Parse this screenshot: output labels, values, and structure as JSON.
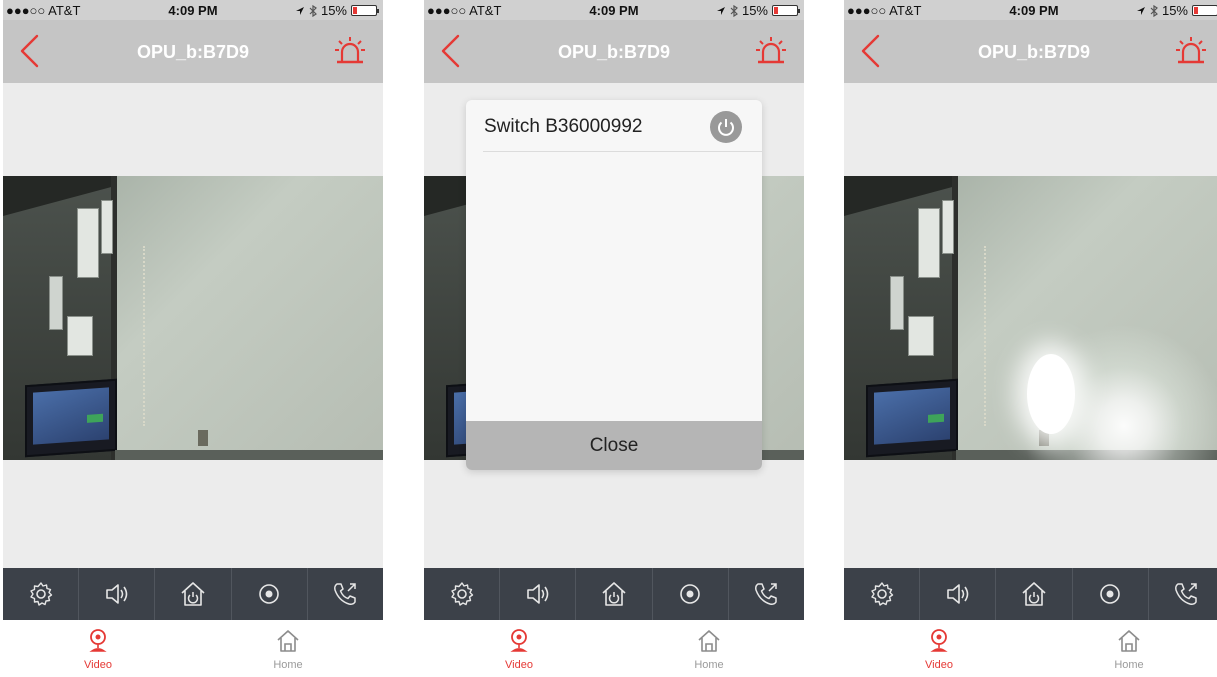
{
  "colors": {
    "accent": "#e53935",
    "navbar": "#c5c5c5",
    "control_bar": "#3c4149",
    "content_bg": "#ececec"
  },
  "screens": [
    {
      "status_bar": {
        "carrier": "●●●○○ AT&T",
        "time": "4:09 PM",
        "battery": "15%"
      },
      "nav": {
        "title": "OPU_b:B7D9",
        "back_icon": "chevron-left-icon",
        "alarm_icon": "siren-icon"
      },
      "video": {
        "lamp_on": false
      },
      "controls": [
        "gear-icon",
        "speaker-icon",
        "home-power-icon",
        "record-icon",
        "phone-call-icon"
      ],
      "tabs": [
        {
          "label": "Video",
          "icon": "camera-icon",
          "active": true
        },
        {
          "label": "Home",
          "icon": "home-icon",
          "active": false
        }
      ]
    },
    {
      "status_bar": {
        "carrier": "●●●○○ AT&T",
        "time": "4:09 PM",
        "battery": "15%"
      },
      "nav": {
        "title": "OPU_b:B7D9",
        "back_icon": "chevron-left-icon",
        "alarm_icon": "siren-icon"
      },
      "video": {
        "lamp_on": false
      },
      "dialog": {
        "switch_name": "Switch B36000992",
        "power_icon": "power-icon",
        "close_label": "Close"
      },
      "controls": [
        "gear-icon",
        "speaker-icon",
        "home-power-icon",
        "record-icon",
        "phone-call-icon"
      ],
      "tabs": [
        {
          "label": "Video",
          "icon": "camera-icon",
          "active": true
        },
        {
          "label": "Home",
          "icon": "home-icon",
          "active": false
        }
      ]
    },
    {
      "status_bar": {
        "carrier": "●●●○○ AT&T",
        "time": "4:09 PM",
        "battery": "15%"
      },
      "nav": {
        "title": "OPU_b:B7D9",
        "back_icon": "chevron-left-icon",
        "alarm_icon": "siren-icon"
      },
      "video": {
        "lamp_on": true
      },
      "controls": [
        "gear-icon",
        "speaker-icon",
        "home-power-icon",
        "record-icon",
        "phone-call-icon"
      ],
      "tabs": [
        {
          "label": "Video",
          "icon": "camera-icon",
          "active": true
        },
        {
          "label": "Home",
          "icon": "home-icon",
          "active": false
        }
      ]
    }
  ]
}
